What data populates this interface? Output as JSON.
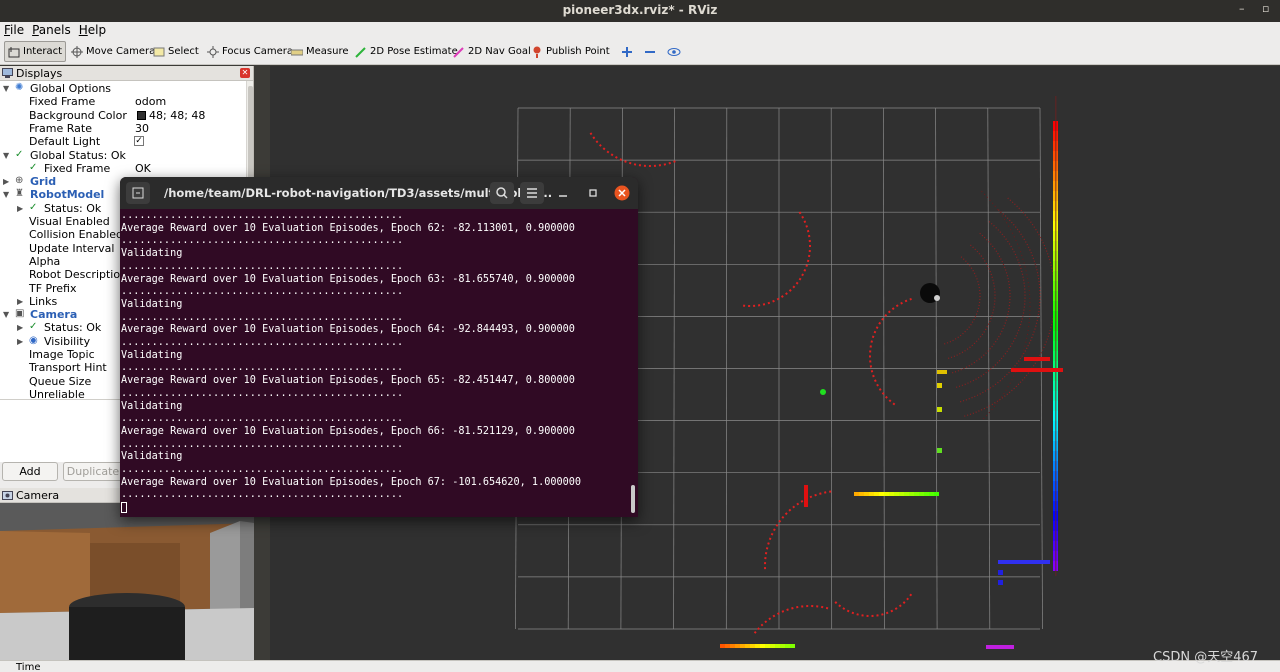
{
  "window": {
    "title": "pioneer3dx.rviz* - RViz"
  },
  "menu": [
    "File",
    "Panels",
    "Help"
  ],
  "toolbar": {
    "interact": "Interact",
    "move_camera": "Move Camera",
    "select": "Select",
    "focus_camera": "Focus Camera",
    "measure": "Measure",
    "pose_estimate": "2D Pose Estimate",
    "nav_goal": "2D Nav Goal",
    "publish_point": "Publish Point"
  },
  "displays": {
    "title": "Displays",
    "rows": [
      {
        "label": "Global Options",
        "value": ""
      },
      {
        "label": "Fixed Frame",
        "value": "odom"
      },
      {
        "label": "Background Color",
        "value": "48; 48; 48"
      },
      {
        "label": "Frame Rate",
        "value": "30"
      },
      {
        "label": "Default Light",
        "value": "✓"
      },
      {
        "label": "Global Status: Ok",
        "value": ""
      },
      {
        "label": "Fixed Frame",
        "value": "OK"
      },
      {
        "label": "Grid",
        "value": ""
      },
      {
        "label": "RobotModel",
        "value": ""
      },
      {
        "label": "Status: Ok",
        "value": ""
      },
      {
        "label": "Visual Enabled",
        "value": ""
      },
      {
        "label": "Collision Enabled",
        "value": ""
      },
      {
        "label": "Update Interval",
        "value": ""
      },
      {
        "label": "Alpha",
        "value": ""
      },
      {
        "label": "Robot Description",
        "value": ""
      },
      {
        "label": "TF Prefix",
        "value": ""
      },
      {
        "label": "Links",
        "value": ""
      },
      {
        "label": "Camera",
        "value": ""
      },
      {
        "label": "Status: Ok",
        "value": ""
      },
      {
        "label": "Visibility",
        "value": ""
      },
      {
        "label": "Image Topic",
        "value": ""
      },
      {
        "label": "Transport Hint",
        "value": ""
      },
      {
        "label": "Queue Size",
        "value": ""
      },
      {
        "label": "Unreliable",
        "value": ""
      }
    ],
    "add_label": "Add",
    "duplicate_label": "Duplicate"
  },
  "camera_panel": {
    "title": "Camera"
  },
  "timebar": {
    "label": "Time"
  },
  "terminal": {
    "title": "/home/team/DRL-robot-navigation/TD3/assets/multi_robot...",
    "lines": [
      "..............................................",
      "Average Reward over 10 Evaluation Episodes, Epoch 62: -82.113001, 0.900000",
      "..............................................",
      "Validating",
      "..............................................",
      "Average Reward over 10 Evaluation Episodes, Epoch 63: -81.655740, 0.900000",
      "..............................................",
      "Validating",
      "..............................................",
      "Average Reward over 10 Evaluation Episodes, Epoch 64: -92.844493, 0.900000",
      "..............................................",
      "Validating",
      "..............................................",
      "Average Reward over 10 Evaluation Episodes, Epoch 65: -82.451447, 0.800000",
      "..............................................",
      "Validating",
      "..............................................",
      "Average Reward over 10 Evaluation Episodes, Epoch 66: -81.521129, 0.900000",
      "..............................................",
      "Validating",
      "..............................................",
      "Average Reward over 10 Evaluation Episodes, Epoch 67: -101.654620, 1.000000",
      ".............................................."
    ]
  },
  "watermark": "CSDN @天空467"
}
